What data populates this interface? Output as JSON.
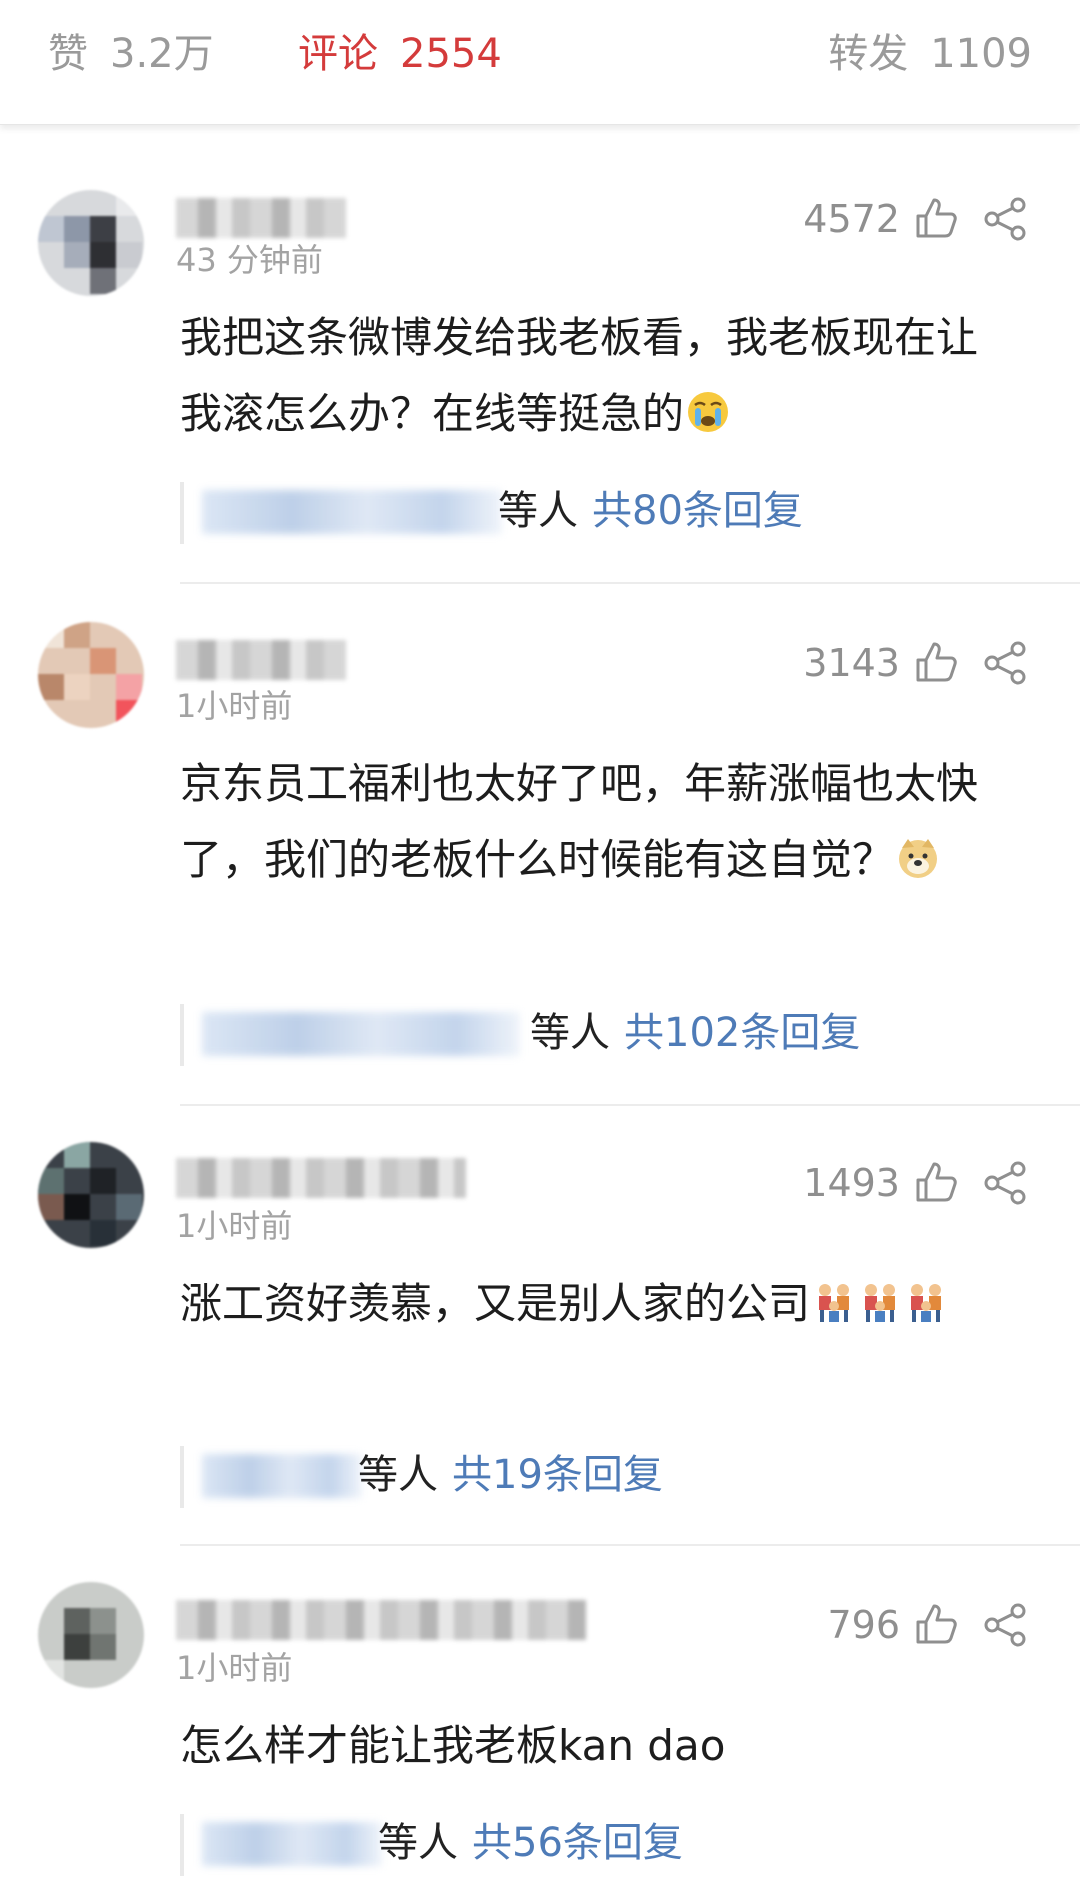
{
  "tabs": [
    {
      "label": "赞",
      "count": "3.2万",
      "active": false
    },
    {
      "label": "评论",
      "count": "2554",
      "active": true
    },
    {
      "label": "转发",
      "count": "1109",
      "active": false
    }
  ],
  "colors": {
    "accent": "#d43b3b",
    "link": "#4e7bb7",
    "muted": "#9a9a9a"
  },
  "comments": [
    {
      "time": "43 分钟前",
      "likes": "4572",
      "text": "我把这条微博发给我老板看，我老板现在让我滚怎么办？在线等挺急的",
      "emoji": "crying-face",
      "reply_suffix": "等人",
      "reply_total": "共80条回复"
    },
    {
      "time": "1小时前",
      "likes": "3143",
      "text": "京东员工福利也太好了吧，年薪涨幅也太快了，我们的老板什么时候能有这自觉？",
      "emoji": "doge",
      "reply_suffix": "等人",
      "reply_total": "共102条回复"
    },
    {
      "time": "1小时前",
      "likes": "1493",
      "text": "涨工资好羡慕，又是别人家的公司",
      "emoji": "family",
      "reply_suffix": "等人",
      "reply_total": "共19条回复"
    },
    {
      "time": "1小时前",
      "likes": "796",
      "text": "怎么样才能让我老板kan dao",
      "emoji": "",
      "reply_suffix": "等人",
      "reply_total": "共56条回复"
    }
  ],
  "icons": {
    "like": "thumbs-up-icon",
    "share": "share-icon"
  }
}
